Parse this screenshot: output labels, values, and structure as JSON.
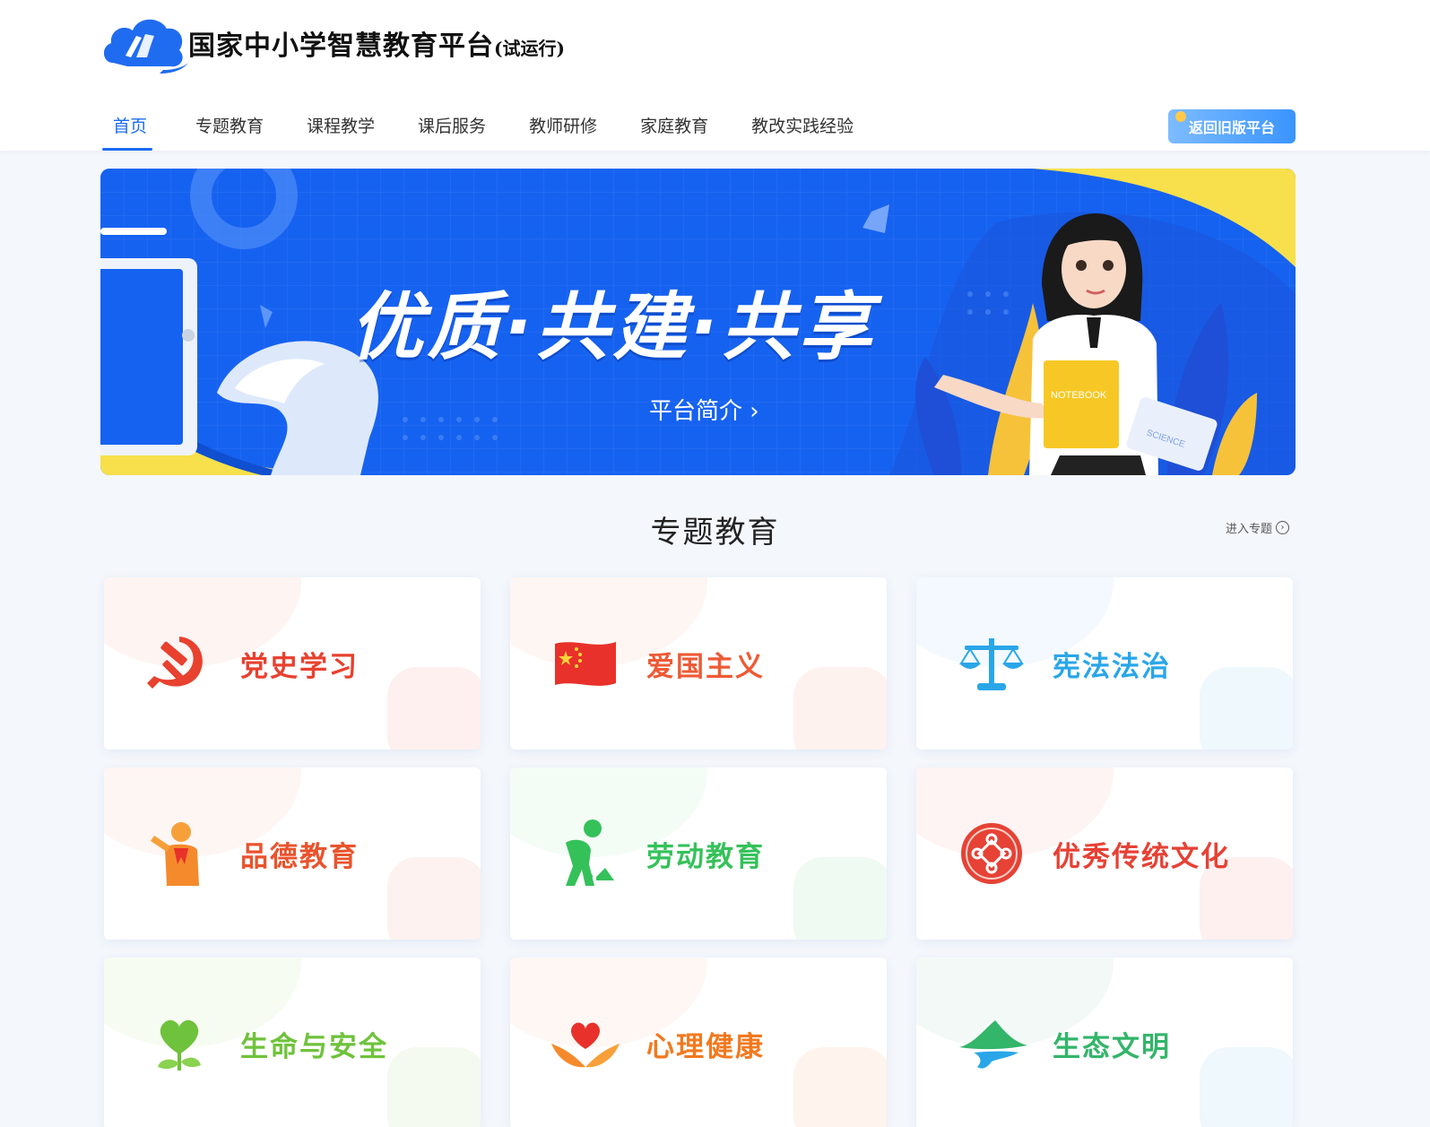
{
  "header": {
    "site_title": "国家中小学智慧教育平台",
    "site_subtitle": "(试运行)",
    "nav": [
      {
        "label": "首页",
        "active": true
      },
      {
        "label": "专题教育"
      },
      {
        "label": "课程教学"
      },
      {
        "label": "课后服务"
      },
      {
        "label": "教师研修"
      },
      {
        "label": "家庭教育"
      },
      {
        "label": "教改实践经验"
      }
    ],
    "old_platform_button": "返回旧版平台"
  },
  "banner": {
    "slogan": "优质·共建·共享",
    "intro_link": "平台简介",
    "notebook_text": "NOTEBOOK",
    "science_text": "SCIENCE"
  },
  "section": {
    "title": "专题教育",
    "enter_link": "进入专题",
    "cards": [
      {
        "label": "党史学习",
        "icon": "hammer-sickle-icon",
        "color": "#e8412f"
      },
      {
        "label": "爱国主义",
        "icon": "china-flag-icon",
        "color": "#ee5a35"
      },
      {
        "label": "宪法法治",
        "icon": "scales-icon",
        "color": "#2aa6e8"
      },
      {
        "label": "品德教育",
        "icon": "young-pioneer-salute-icon",
        "color": "#e9532d"
      },
      {
        "label": "劳动教育",
        "icon": "worker-digging-icon",
        "color": "#35c15a"
      },
      {
        "label": "优秀传统文化",
        "icon": "chinese-knot-icon",
        "color": "#e64235"
      },
      {
        "label": "生命与安全",
        "icon": "heart-sprout-icon",
        "color": "#6fc23b"
      },
      {
        "label": "心理健康",
        "icon": "heart-hands-icon",
        "color": "#f2791f"
      },
      {
        "label": "生态文明",
        "icon": "mountain-water-icon",
        "color": "#33b56a"
      }
    ]
  },
  "colors": {
    "primary": "#1a6cf2",
    "banner_blue": "#1662f0",
    "banner_yellow": "#f7e04b",
    "page_bg": "#f4f7fc"
  }
}
